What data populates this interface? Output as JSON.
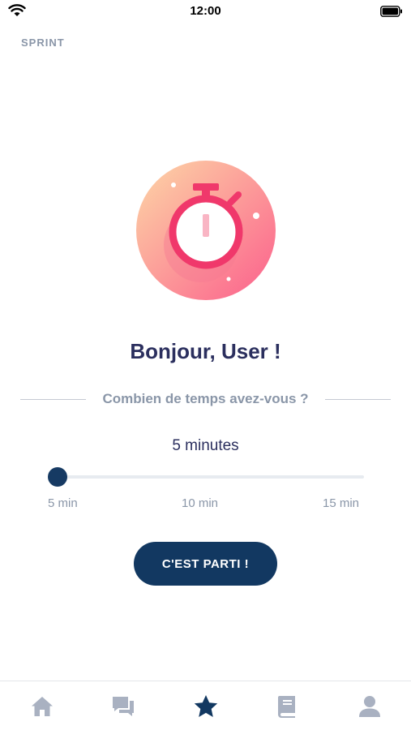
{
  "status_bar": {
    "time": "12:00"
  },
  "header": {
    "label": "SPRINT"
  },
  "main": {
    "greeting": "Bonjour, User !",
    "question": "Combien de temps avez-vous ?",
    "duration_label": "5 minutes",
    "slider": {
      "value_minutes": 5,
      "min_minutes": 5,
      "max_minutes": 15,
      "ticks": [
        "5 min",
        "10 min",
        "15 min"
      ]
    },
    "start_button_label": "C'EST PARTI !"
  },
  "tab_bar": {
    "items": [
      {
        "icon": "home-icon",
        "active": false
      },
      {
        "icon": "chat-icon",
        "active": false
      },
      {
        "icon": "star-icon",
        "active": true
      },
      {
        "icon": "book-icon",
        "active": false
      },
      {
        "icon": "user-icon",
        "active": false
      }
    ]
  },
  "colors": {
    "primary": "#123861",
    "heading": "#2b2f5e",
    "muted": "#8a96a8",
    "accent": "#f0386b",
    "tab_inactive": "#a9b1c1"
  }
}
